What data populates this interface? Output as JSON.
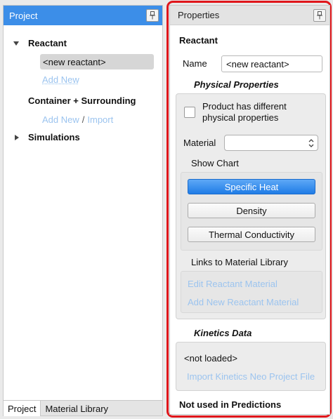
{
  "project_panel": {
    "title": "Project",
    "reactant_label": "Reactant",
    "selected_reactant": "<new reactant>",
    "add_new_reactant": "Add New",
    "container_label": "Container + Surrounding",
    "container_add_new": "Add New",
    "container_separator": "/",
    "container_import": "Import",
    "simulations_label": "Simulations",
    "tabs": [
      "Project",
      "Material Library"
    ]
  },
  "properties_panel": {
    "title": "Properties",
    "section_title": "Reactant",
    "name_label": "Name",
    "name_value": "<new reactant>",
    "physical_properties_title": "Physical Properties",
    "product_checkbox_label_line1": "Product has different",
    "product_checkbox_label_line2": "physical properties",
    "material_label": "Material",
    "material_value": "",
    "show_chart_label": "Show Chart",
    "chart_buttons": [
      "Specific Heat",
      "Density",
      "Thermal Conductivity"
    ],
    "links_title": "Links to Material Library",
    "edit_material_link": "Edit Reactant Material",
    "add_material_link": "Add New Reactant Material",
    "kinetics_title": "Kinetics Data",
    "kinetics_status": "<not loaded>",
    "import_kinetics_link": "Import Kinetics Neo Project File",
    "not_used_title": "Not used in Predictions"
  },
  "colors": {
    "header_accent": "#3c8ee8",
    "primary_button": "#1f7ce6",
    "link": "#5aa0e8",
    "highlight_outline": "#e0161b"
  }
}
